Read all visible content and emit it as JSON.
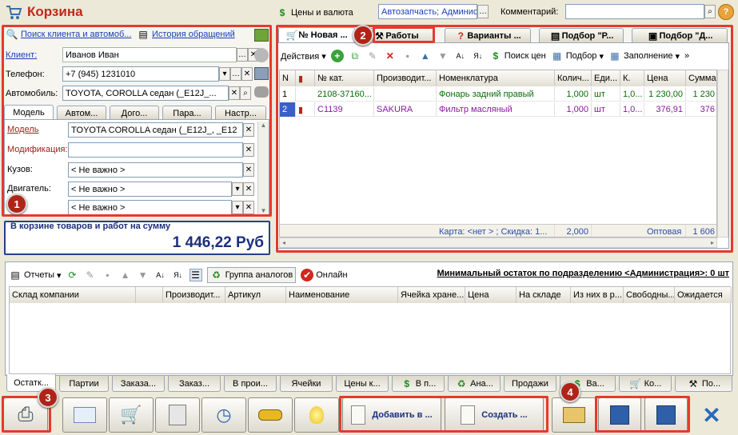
{
  "window": {
    "title": "Корзина",
    "currency_label": "Цены и валюта",
    "org_value": "Автозапчасть; Админис",
    "comment_label": "Комментарий:",
    "comment_value": ""
  },
  "left": {
    "search_link": "Поиск клиента и автомоб...",
    "history_link": "История обращений",
    "client_label": "Клиент:",
    "client_value": "Иванов Иван",
    "phone_label": "Телефон:",
    "phone_value": "+7 (945) 1231010",
    "car_label": "Автомобиль:",
    "car_value": "TOYOTA, COROLLA седан (_E12J_...",
    "tabs": [
      "Модель",
      "Автом...",
      "Дого...",
      "Пара...",
      "Настр..."
    ],
    "model_label": "Модель",
    "model_value": "TOYOTA COROLLA седан (_E12J_, _E12",
    "mod_label": "Модификация:",
    "mod_value": "",
    "body_label": "Кузов:",
    "body_value": "< Не важно >",
    "engine_label": "Двигатель:",
    "engine_value": "< Не важно >",
    "extra_value": "< Не важно >"
  },
  "summary": {
    "label": "В корзине товаров и работ на сумму",
    "amount": "1 446,22 Руб"
  },
  "right": {
    "tabs": [
      "№ Новая ...",
      "Работы",
      "Варианты ...",
      "Подбор \"Р...",
      "Подбор \"Д..."
    ],
    "toolbar": {
      "actions": "Действия",
      "price_search": "Поиск цен",
      "pick": "Подбор",
      "fill": "Заполнение"
    },
    "columns": [
      "N",
      "",
      "№ кат.",
      "Производит...",
      "Номенклатура",
      "Колич...",
      "Еди...",
      "К.",
      "Цена",
      "Сумма"
    ],
    "rows": [
      {
        "n": "1",
        "cat": "2108-37160...",
        "maker": "",
        "name": "Фонарь задний правый",
        "qty": "1,000",
        "unit": "шт",
        "k": "1,0...",
        "price": "1 230,00",
        "sum": "1 230"
      },
      {
        "n": "2",
        "cat": "C1139",
        "maker": "SAKURA",
        "name": "Фильтр масляный",
        "qty": "1,000",
        "unit": "шт",
        "k": "1,0...",
        "price": "376,91",
        "sum": "376"
      }
    ],
    "footer": {
      "card": "Карта: <нет > ; Скидка: 1...",
      "qty": "2,000",
      "price_type": "Оптовая",
      "sum": "1 606"
    }
  },
  "bottom": {
    "toolbar": {
      "reports": "Отчеты",
      "analogs": "Группа аналогов",
      "online": "Онлайн",
      "min_stock": "Минимальный остаток по подразделению <Администрация>: 0 шт"
    },
    "columns": [
      "Склад компании",
      "",
      "Производит...",
      "Артикул",
      "Наименование",
      "Ячейка хране...",
      "Цена",
      "На складе",
      "Из них в р...",
      "Свободны...",
      "Ожидается"
    ],
    "tabs": [
      "Остатк...",
      "Партии",
      "Заказа...",
      "Заказ...",
      "В прои...",
      "Ячейки",
      "Цены к...",
      "В п...",
      "Ана...",
      "Продажи",
      "Ва...",
      "Ко...",
      "По..."
    ]
  },
  "actions": {
    "add": "Добавить в ...",
    "create": "Создать ..."
  },
  "badges": [
    "1",
    "2",
    "3",
    "4"
  ],
  "colors": {
    "annotation": "#e53a2d",
    "badge": "#b02418",
    "title": "#c0281c",
    "purple_row": "#8a1a9e",
    "green_row": "#0a6b0a"
  }
}
